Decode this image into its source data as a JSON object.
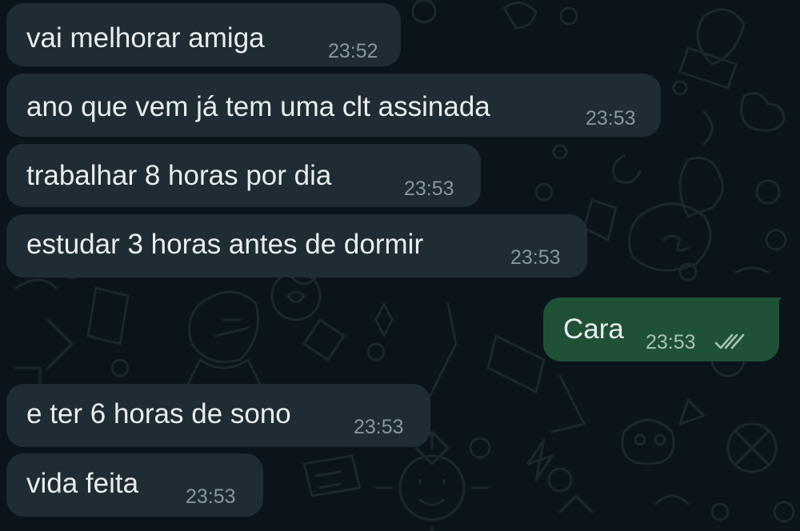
{
  "conversation": {
    "messages": [
      {
        "direction": "incoming",
        "text": "vai melhorar amiga",
        "time": "23:52"
      },
      {
        "direction": "incoming",
        "text": "ano que vem já tem uma clt assinada",
        "time": "23:53"
      },
      {
        "direction": "incoming",
        "text": "trabalhar 8 horas por dia",
        "time": "23:53"
      },
      {
        "direction": "incoming",
        "text": "estudar 3 horas antes de dormir",
        "time": "23:53"
      },
      {
        "direction": "outgoing",
        "text": "Cara",
        "time": "23:53",
        "status": "read"
      },
      {
        "direction": "incoming",
        "text": "e ter 6 horas de sono",
        "time": "23:53"
      },
      {
        "direction": "incoming",
        "text": "vida feita",
        "time": "23:53"
      }
    ]
  },
  "colors": {
    "background": "#0b141a",
    "incoming_bubble": "#202c33",
    "outgoing_bubble": "#1f5137",
    "text": "#e9edef",
    "timestamp": "#8696a0",
    "wallpaper_doodle": "#1c262d"
  },
  "icons": {
    "read_receipt": "double-check-icon"
  }
}
